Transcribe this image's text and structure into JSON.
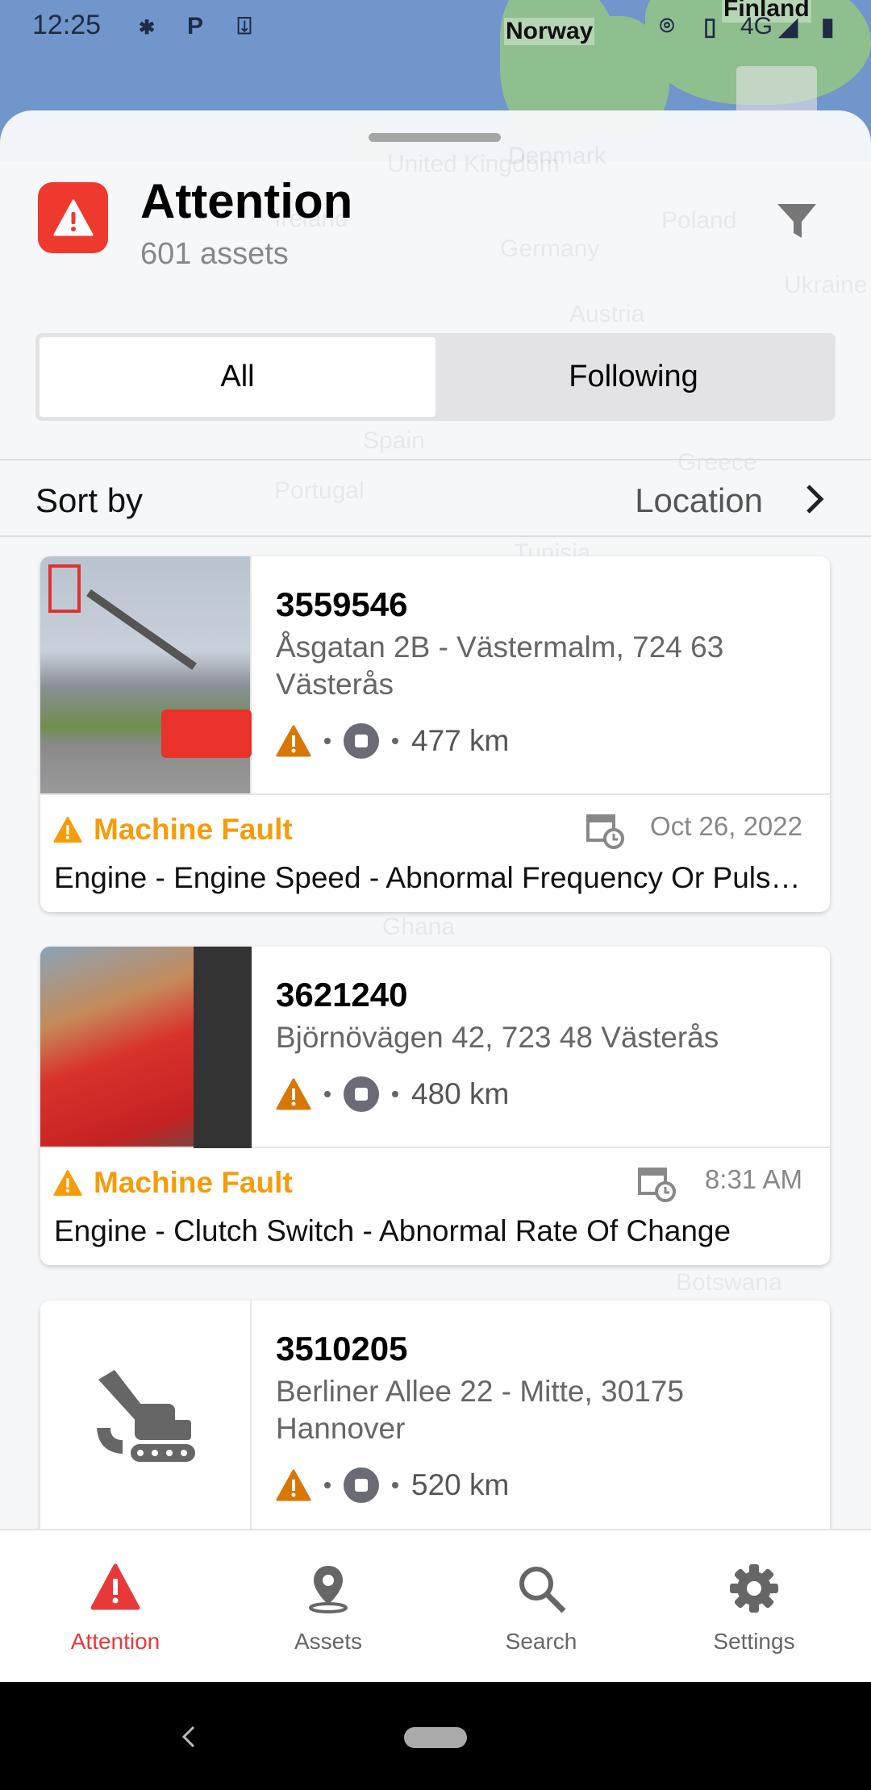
{
  "status_bar": {
    "time": "12:25",
    "network": "4G",
    "icons": [
      "bluetooth-icon",
      "parking-icon",
      "download-icon",
      "location-icon",
      "vibrate-icon",
      "signal-icon",
      "battery-charging-icon"
    ]
  },
  "map": {
    "labels": [
      "Norway",
      "Finland"
    ],
    "ghost_labels": [
      "United Kingdom",
      "Ireland",
      "Denmark",
      "Poland",
      "Germany",
      "Ukraine",
      "Austria",
      "Spain",
      "Portugal",
      "Greece",
      "Tunisia",
      "Ghana",
      "Botswana"
    ]
  },
  "header": {
    "title": "Attention",
    "subtitle": "601 assets",
    "icon": "warning-icon",
    "filter_icon": "filter-icon"
  },
  "segmented": {
    "options": [
      "All",
      "Following"
    ],
    "selected": "All"
  },
  "sort": {
    "label": "Sort by",
    "value": "Location"
  },
  "colors": {
    "accent_red": "#f0392e",
    "fault_orange": "#f59c0a",
    "warning_dark_orange": "#d97706"
  },
  "assets": [
    {
      "id": "3559546",
      "address": "Åsgatan 2B - Västermalm, 724 63 Västerås",
      "distance": "477 km",
      "alert_type": "Machine Fault",
      "date": "Oct 26, 2022",
      "description": "Engine - Engine Speed - Abnormal Frequency Or Pulse Width"
    },
    {
      "id": "3621240",
      "address": "Björnövägen 42, 723 48 Västerås",
      "distance": "480 km",
      "alert_type": "Machine Fault",
      "date": "8:31 AM",
      "description": "Engine - Clutch Switch - Abnormal Rate Of Change"
    },
    {
      "id": "3510205",
      "address": "Berliner Allee 22 - Mitte, 30175 Hannover",
      "distance": "520 km"
    }
  ],
  "bottom_nav": [
    {
      "label": "Attention",
      "icon": "warning-icon",
      "active": true
    },
    {
      "label": "Assets",
      "icon": "map-pin-icon",
      "active": false
    },
    {
      "label": "Search",
      "icon": "search-icon",
      "active": false
    },
    {
      "label": "Settings",
      "icon": "gear-icon",
      "active": false
    }
  ]
}
